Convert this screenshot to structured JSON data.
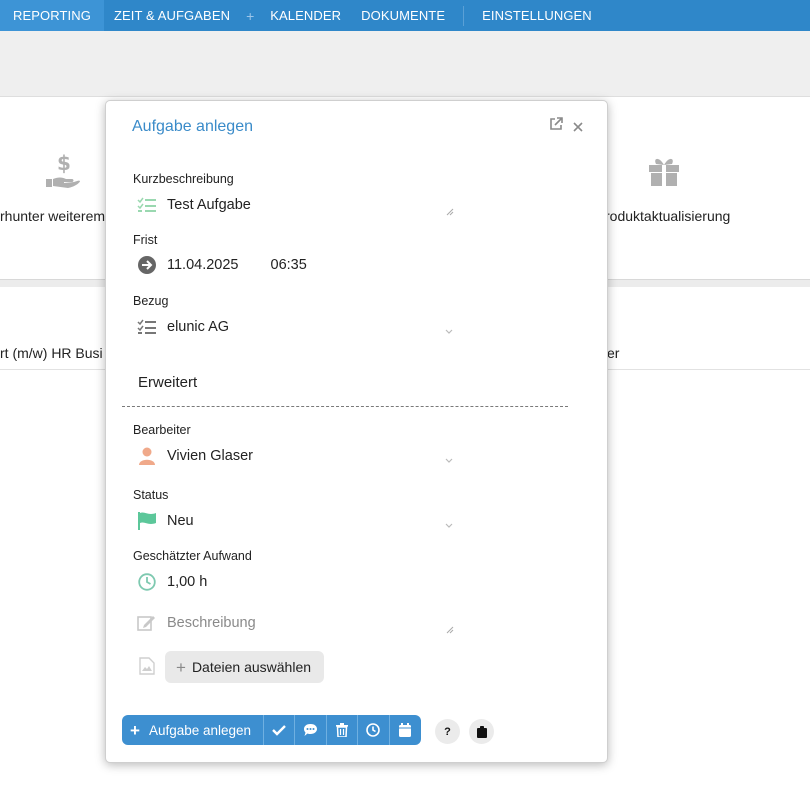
{
  "nav": {
    "items": [
      "REPORTING",
      "ZEIT & AUFGABEN",
      "+",
      "KALENDER",
      "DOKUMENTE",
      "EINSTELLUNGEN"
    ]
  },
  "background": {
    "tile_left_label": "rhunter weiterem",
    "tile_right_label": "roduktaktualisierung",
    "row_left_text": "rt (m/w) HR Busi",
    "row_right_text": "er",
    "icons": [
      "hand-dollar-icon",
      "gift-icon"
    ]
  },
  "modal": {
    "title": "Aufgabe anlegen",
    "icons": [
      "external-link-icon",
      "close-icon"
    ],
    "kurzbeschreibung": {
      "label": "Kurzbeschreibung",
      "value": "Test Aufgabe"
    },
    "frist": {
      "label": "Frist",
      "date": "11.04.2025",
      "time": "06:35"
    },
    "bezug": {
      "label": "Bezug",
      "value": "elunic AG"
    },
    "section": "Erweitert",
    "bearbeiter": {
      "label": "Bearbeiter",
      "value": "Vivien Glaser"
    },
    "status": {
      "label": "Status",
      "value": "Neu"
    },
    "aufwand": {
      "label": "Geschätzter Aufwand",
      "value": "1,00 h"
    },
    "beschreibung": {
      "placeholder": "Beschreibung"
    },
    "files_button": "Dateien auswählen",
    "actions": {
      "primary": "Aufgabe anlegen",
      "icons": [
        "check-icon",
        "comment-icon",
        "trash-icon",
        "clock-icon",
        "calendar-icon"
      ]
    },
    "help_label": "?",
    "colors": {
      "accent": "#3a8bc9",
      "nav": "#2f87c9",
      "status_flag": "#5cc79a",
      "avatar": "#f0a98a"
    }
  }
}
